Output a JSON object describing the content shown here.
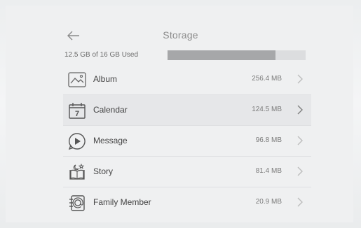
{
  "header": {
    "title": "Storage",
    "back_icon": "arrow-left-icon"
  },
  "storage": {
    "used_text": "12.5 GB of 16 GB Used",
    "used_fraction": 0.78
  },
  "items": [
    {
      "label": "Album",
      "size": "256.4 MB",
      "icon": "picture-icon"
    },
    {
      "label": "Calendar",
      "size": "124.5 MB",
      "icon": "calendar-icon",
      "calendar_day": "7"
    },
    {
      "label": "Message",
      "size": "96.8 MB",
      "icon": "play-circle-icon"
    },
    {
      "label": "Story",
      "size": "81.4 MB",
      "icon": "story-icon"
    },
    {
      "label": "Family Member",
      "size": "20.9 MB",
      "icon": "contacts-icon"
    }
  ],
  "colors": {
    "bar_fill": "#a6a7a9",
    "bar_track": "#dcdddf",
    "selected_row": "#e6e7e9"
  }
}
